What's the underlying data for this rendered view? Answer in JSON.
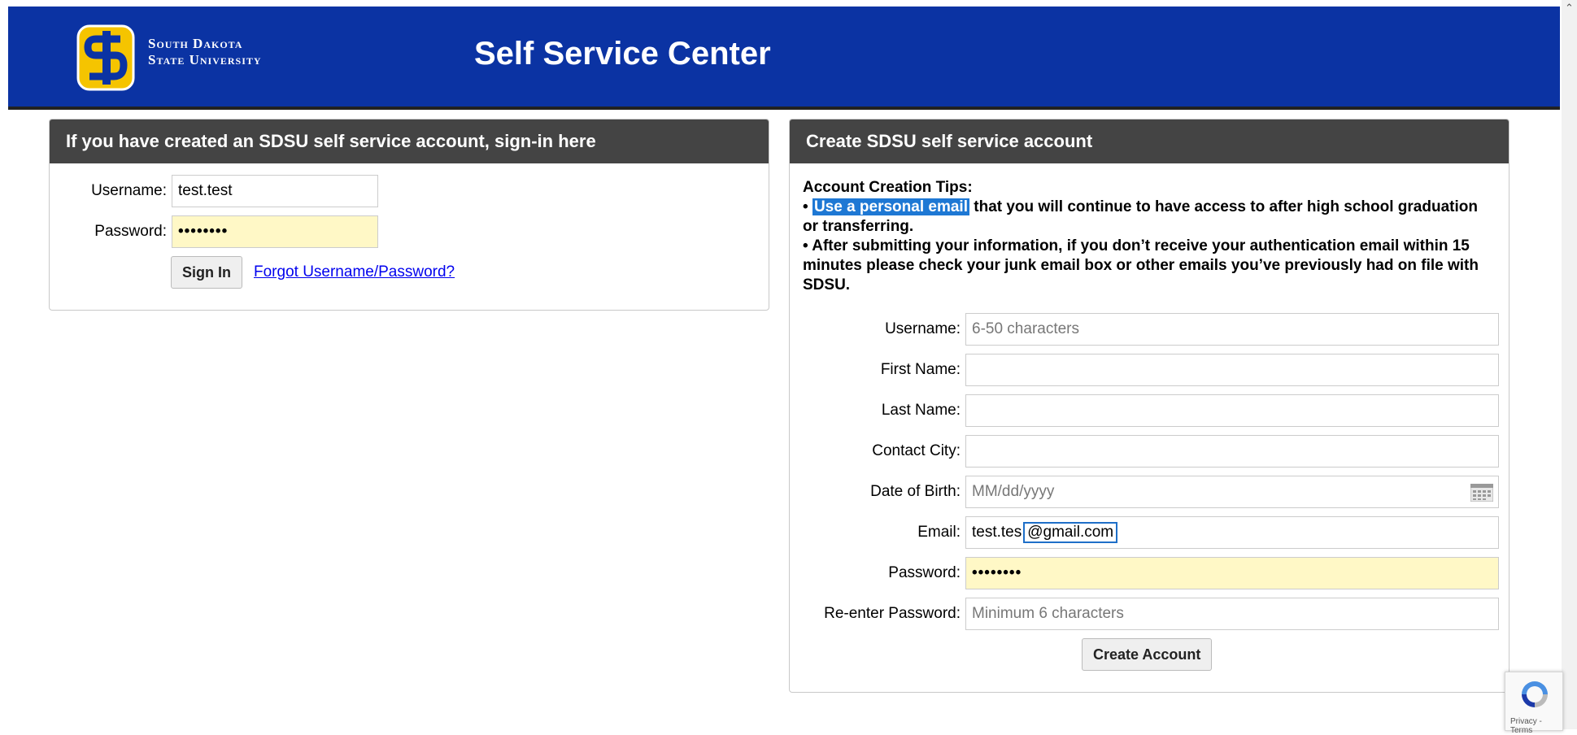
{
  "header": {
    "university_line1": "South Dakota",
    "university_line2": "State University",
    "title": "Self Service Center",
    "colors": {
      "brand_blue": "#0b33a3",
      "logo_yellow": "#f5c400"
    }
  },
  "signin": {
    "heading": "If you have created an SDSU self service account, sign-in here",
    "username_label": "Username:",
    "username_value": "test.test",
    "password_label": "Password:",
    "password_value": "••••••••",
    "signin_button": "Sign In",
    "forgot_link": "Forgot Username/Password?"
  },
  "create": {
    "heading": "Create SDSU self service account",
    "tips_title": "Account Creation Tips:",
    "tip1_highlight": "Use a personal email",
    "tip1_rest": " that you will continue to have access to after high school graduation or transferring.",
    "tip2": "After submitting your information, if you don’t receive your authentication email within 15 minutes please check your junk email box or other emails you’ve previously had on file with SDSU.",
    "bullet": "•",
    "fields": {
      "username": {
        "label": "Username:",
        "placeholder": "6-50 characters"
      },
      "first_name": {
        "label": "First Name:"
      },
      "last_name": {
        "label": "Last Name:"
      },
      "contact_city": {
        "label": "Contact City:"
      },
      "dob": {
        "label": "Date of Birth:",
        "placeholder": "MM/dd/yyyy"
      },
      "email": {
        "label": "Email:",
        "value_prefix": "test.tes",
        "value_selected": "@gmail.com"
      },
      "password": {
        "label": "Password:",
        "value": "••••••••"
      },
      "reenter": {
        "label": "Re-enter Password:",
        "placeholder": "Minimum 6 characters"
      }
    },
    "create_button": "Create Account"
  },
  "recaptcha": {
    "text": "Privacy - Terms"
  }
}
